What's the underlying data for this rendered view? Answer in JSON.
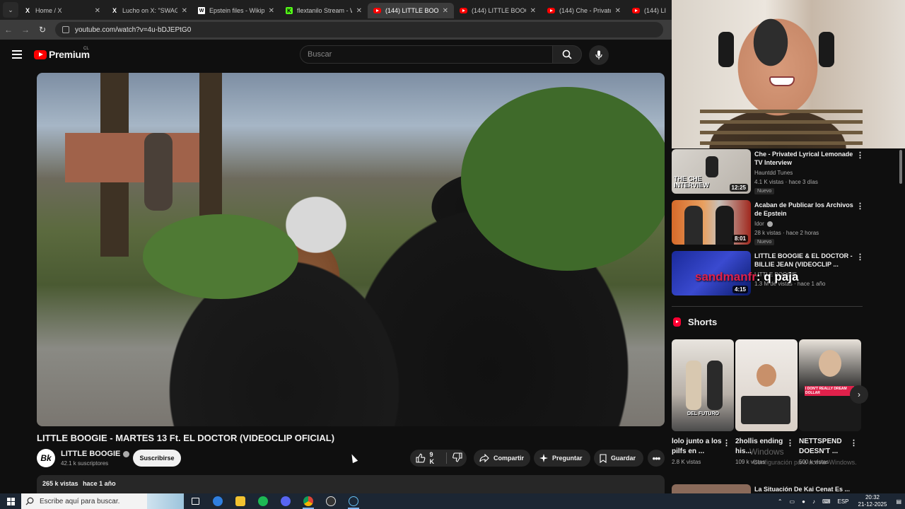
{
  "browser": {
    "tabs": [
      {
        "title": "Home / X",
        "icon": "x-logo-icon"
      },
      {
        "title": "Lucho on X: \"SWAGG",
        "icon": "x-logo-icon"
      },
      {
        "title": "Epstein files - Wikipe",
        "icon": "wikipedia-icon"
      },
      {
        "title": "flextanilo Stream - W",
        "icon": "kick-icon"
      },
      {
        "title": "(144) LITTLE BOOGIE",
        "icon": "youtube-icon",
        "active": true
      },
      {
        "title": "(144) LITTLE BOOGIE",
        "icon": "youtube-icon"
      },
      {
        "title": "(144) Che - Privated L",
        "icon": "youtube-icon"
      },
      {
        "title": "(144) LITTL",
        "icon": "youtube-icon"
      }
    ],
    "url": "youtube.com/watch?v=4u-bDJEPtG0"
  },
  "youtube": {
    "logo_text": "Premium",
    "region": "CL",
    "search_placeholder": "Buscar"
  },
  "video": {
    "title": "LITTLE BOOGIE - MARTES 13 Ft. EL DOCTOR (VIDEOCLIP OFICIAL)",
    "channel": {
      "name": "LITTLE BOOGIE",
      "avatar_letter": "Bk",
      "subscribers": "42.1 k suscriptores"
    },
    "subscribe_label": "Suscribirse",
    "likes": "9 K",
    "share_label": "Compartir",
    "ask_label": "Preguntar",
    "save_label": "Guardar",
    "views": "265 k vistas",
    "age": "hace 1 año"
  },
  "recommendations": [
    {
      "title": "Che - Privated Lyrical Lemonade TV Interview",
      "channel": "Hauntdd Tunes",
      "meta": "4.1 K vistas · hace 3 días",
      "badge": "Nuevo",
      "duration": "12:25",
      "thumb_text": "THE CHE INTERVIEW"
    },
    {
      "title": "Acaban de Publicar los Archivos de Epstein",
      "channel": "Idor",
      "meta": "28 k vistas · hace 2 horas",
      "badge": "Nuevo",
      "duration": "8:01"
    },
    {
      "title": "LITTLE BOOGIE & EL DOCTOR - BILLIE JEAN (VIDEOCLIP ...",
      "channel": "LITTLE BOOGIE",
      "meta": "1.3 M de vistas · hace 1 año",
      "duration": "4:15"
    }
  ],
  "overlay_text": {
    "red": "sandmanfr",
    "white": ": q paja"
  },
  "shorts": {
    "heading": "Shorts",
    "items": [
      {
        "title": "lolo junto a los pilfs en ...",
        "views": "2.8 K vistas",
        "thumb_text": "DEL FUTURO"
      },
      {
        "title": "2hollis ending his...",
        "views": "109 k vistas"
      },
      {
        "title": "NETTSPEND DOESN'T ...",
        "views": "500 k vistas",
        "thumb_text": "I DON'T REALLY DREAM DOLLAR"
      }
    ]
  },
  "windows_watermark": {
    "line1": "Windows",
    "line2": "Configuración para activar Windows."
  },
  "next_rec_title": "La Situación De Kai Cenat Es ...",
  "taskbar": {
    "search_placeholder": "Escribe aquí para buscar.",
    "language": "ESP",
    "time": "20:32",
    "date": "21-12-2025"
  }
}
